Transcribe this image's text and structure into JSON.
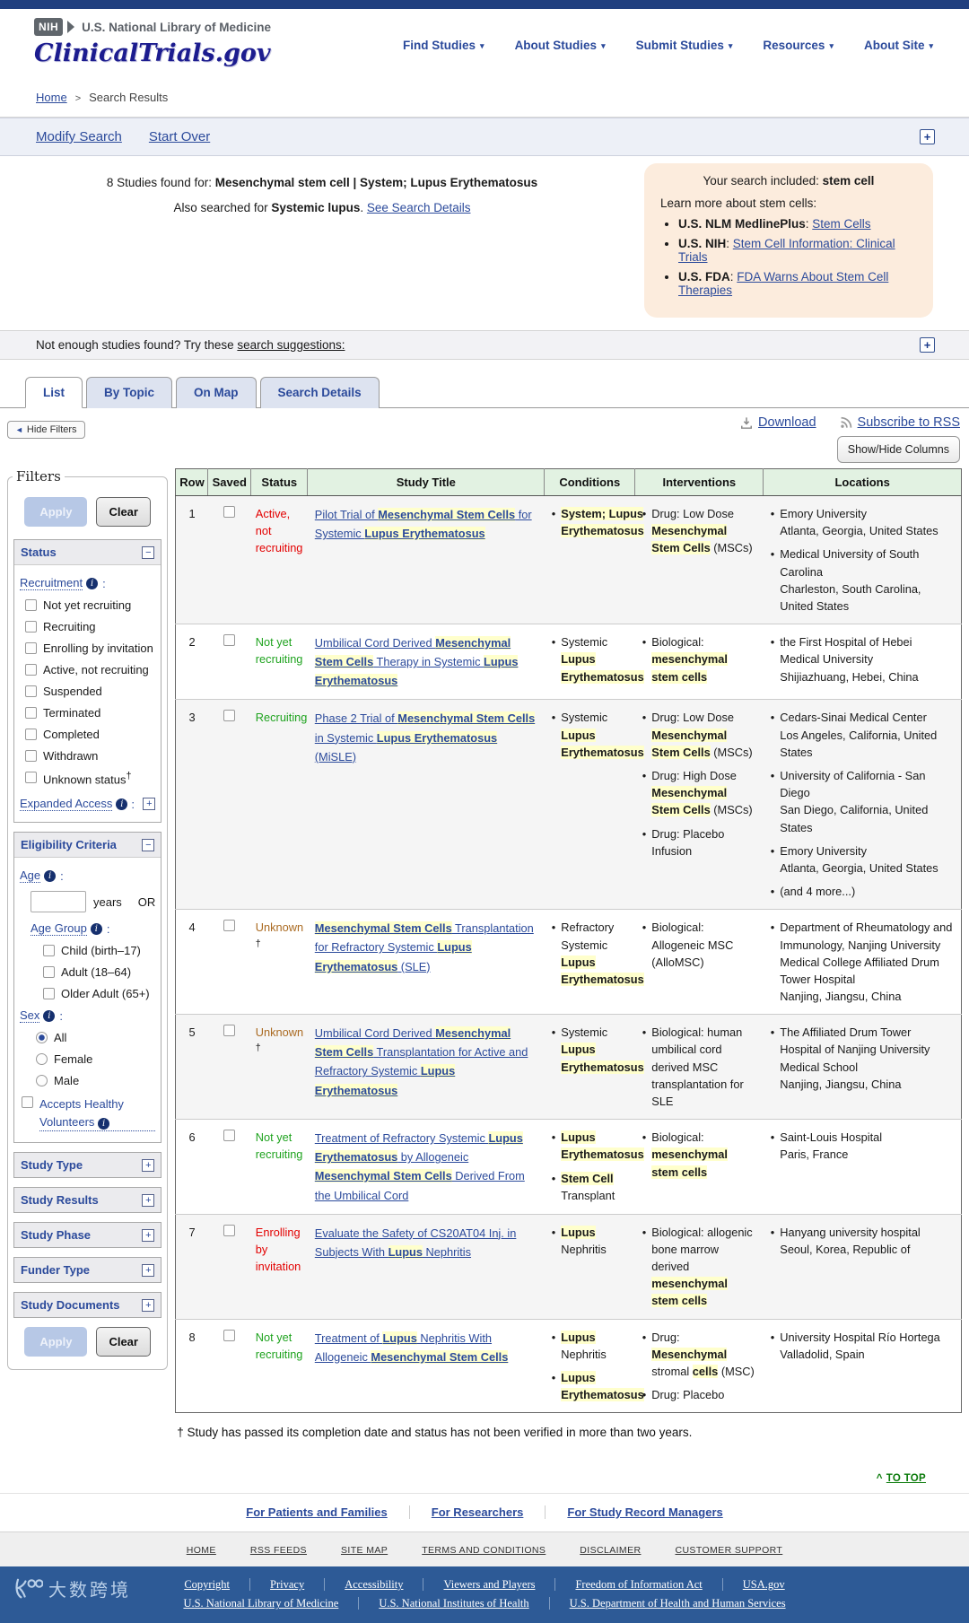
{
  "colors": {
    "accent_blue": "#2b4a9b",
    "navy_bar": "#21407f",
    "footer_navy": "#2d5a96",
    "status_red": "#e30000",
    "status_green": "#1fa31f",
    "status_unknown": "#aa6a21",
    "highlight": "#ffffcc",
    "table_header_green": "#e2f2e2",
    "info_box_bg": "#fcecdd"
  },
  "dagger": "†",
  "header": {
    "nih_label": "NIH",
    "org": "U.S. National Library of Medicine",
    "site_title": "ClinicalTrials.gov",
    "nav": [
      "Find Studies",
      "About Studies",
      "Submit Studies",
      "Resources",
      "About Site"
    ]
  },
  "breadcrumb": {
    "home": "Home",
    "current": "Search Results"
  },
  "toolbar": {
    "modify_search": "Modify Search",
    "start_over": "Start Over"
  },
  "results_summary": {
    "count_prefix": "8 Studies found for: ",
    "count_bold": "Mesenchymal stem cell | System; Lupus Erythematosus",
    "also_prefix": "Also searched for ",
    "also_bold": "Systemic lupus",
    "also_suffix": ". ",
    "see_details_link": "See Search Details"
  },
  "info_box": {
    "title_prefix": "Your search included: ",
    "title_bold": "stem cell",
    "subtitle": "Learn more about stem cells:",
    "items": [
      {
        "label": "U.S. NLM MedlinePlus",
        "link": "Stem Cells"
      },
      {
        "label": "U.S. NIH",
        "link": "Stem Cell Information: Clinical Trials"
      },
      {
        "label": "U.S. FDA",
        "link": "FDA Warns About Stem Cell Therapies"
      }
    ]
  },
  "suggestions_bar": {
    "prefix": "Not enough studies found? Try these ",
    "link": "search suggestions:"
  },
  "tabs": [
    "List",
    "By Topic",
    "On Map",
    "Search Details"
  ],
  "active_tab": "List",
  "hide_filters_label": "Hide Filters",
  "actions": {
    "download": "Download",
    "rss": "Subscribe to RSS",
    "columns": "Show/Hide Columns"
  },
  "filters": {
    "legend": "Filters",
    "apply": "Apply",
    "clear": "Clear",
    "status_panel": {
      "title": "Status",
      "recruitment_label": "Recruitment",
      "options": [
        "Not yet recruiting",
        "Recruiting",
        "Enrolling by invitation",
        "Active, not recruiting",
        "Suspended",
        "Terminated",
        "Completed",
        "Withdrawn",
        "Unknown status"
      ],
      "dagger_option": "Unknown status",
      "expanded_access_label": "Expanded Access"
    },
    "eligibility_panel": {
      "title": "Eligibility Criteria",
      "age_label": "Age",
      "age_value": "",
      "age_unit": "years",
      "or_label": "OR",
      "age_group_label": "Age Group",
      "age_groups": [
        "Child (birth–17)",
        "Adult (18–64)",
        "Older Adult (65+)"
      ],
      "sex_label": "Sex",
      "sex_options": [
        "All",
        "Female",
        "Male"
      ],
      "sex_selected": "All",
      "healthy_label": "Accepts Healthy Volunteers"
    },
    "collapsed_panels": [
      "Study Type",
      "Study Results",
      "Study Phase",
      "Funder Type",
      "Study Documents"
    ]
  },
  "table": {
    "headers": [
      "Row",
      "Saved",
      "Status",
      "Study Title",
      "Conditions",
      "Interventions",
      "Locations"
    ],
    "rows": [
      {
        "num": "1",
        "status": "Active, not recruiting",
        "color": "red",
        "dagger": false,
        "title": [
          {
            "t": "Pilot Trial of "
          },
          {
            "t": "Mesenchymal Stem Cells",
            "hl": true
          },
          {
            "t": " for Systemic "
          },
          {
            "t": "Lupus Erythematosus",
            "hl": true
          }
        ],
        "conditions": [
          [
            {
              "t": "System; Lupus Erythematosus",
              "hl": true
            }
          ]
        ],
        "interventions": [
          [
            {
              "t": "Drug: Low Dose "
            },
            {
              "t": "Mesenchymal Stem Cells",
              "hl": true
            },
            {
              "t": " (MSCs)"
            }
          ]
        ],
        "locations": [
          [
            "Emory University",
            "Atlanta, Georgia, United States"
          ],
          [
            "Medical University of South Carolina",
            "Charleston, South Carolina, United States"
          ]
        ]
      },
      {
        "num": "2",
        "status": "Not yet recruiting",
        "color": "green",
        "dagger": false,
        "title": [
          {
            "t": "Umbilical Cord Derived "
          },
          {
            "t": "Mesenchymal Stem Cells",
            "hl": true
          },
          {
            "t": " Therapy in Systemic "
          },
          {
            "t": "Lupus Erythematosus",
            "hl": true
          }
        ],
        "conditions": [
          [
            {
              "t": "Systemic "
            },
            {
              "t": "Lupus Erythematosus",
              "hl": true
            }
          ]
        ],
        "interventions": [
          [
            {
              "t": "Biological: "
            },
            {
              "t": "mesenchymal stem cells",
              "hl": true
            }
          ]
        ],
        "locations": [
          [
            "the First Hospital of Hebei Medical University",
            "Shijiazhuang, Hebei, China"
          ]
        ]
      },
      {
        "num": "3",
        "status": "Recruiting",
        "color": "green",
        "dagger": false,
        "title": [
          {
            "t": "Phase 2 Trial of "
          },
          {
            "t": "Mesenchymal Stem Cells",
            "hl": true
          },
          {
            "t": " in Systemic "
          },
          {
            "t": "Lupus Erythematosus",
            "hl": true
          },
          {
            "t": " (MiSLE)"
          }
        ],
        "conditions": [
          [
            {
              "t": "Systemic "
            },
            {
              "t": "Lupus Erythematosus",
              "hl": true
            }
          ]
        ],
        "interventions": [
          [
            {
              "t": "Drug: Low Dose "
            },
            {
              "t": "Mesenchymal Stem Cells",
              "hl": true
            },
            {
              "t": " (MSCs)"
            }
          ],
          [
            {
              "t": "Drug: High Dose "
            },
            {
              "t": "Mesenchymal Stem Cells",
              "hl": true
            },
            {
              "t": " (MSCs)"
            }
          ],
          [
            {
              "t": "Drug: Placebo Infusion"
            }
          ]
        ],
        "locations": [
          [
            "Cedars-Sinai Medical Center",
            "Los Angeles, California, United States"
          ],
          [
            "University of California - San Diego",
            "San Diego, California, United States"
          ],
          [
            "Emory University",
            "Atlanta, Georgia, United States"
          ],
          [
            "(and 4 more...)"
          ]
        ]
      },
      {
        "num": "4",
        "status": "Unknown",
        "color": "unknown",
        "dagger": true,
        "title": [
          {
            "t": "Mesenchymal Stem Cells",
            "hl": true
          },
          {
            "t": " Transplantation for Refractory Systemic "
          },
          {
            "t": "Lupus Erythematosus",
            "hl": true
          },
          {
            "t": " (SLE)"
          }
        ],
        "conditions": [
          [
            {
              "t": "Refractory Systemic "
            },
            {
              "t": "Lupus Erythematosus",
              "hl": true
            }
          ]
        ],
        "interventions": [
          [
            {
              "t": "Biological: Allogeneic MSC (AlloMSC)"
            }
          ]
        ],
        "locations": [
          [
            "Department of Rheumatology and Immunology, Nanjing University Medical College Affiliated Drum Tower Hospital",
            "Nanjing, Jiangsu, China"
          ]
        ]
      },
      {
        "num": "5",
        "status": "Unknown",
        "color": "unknown",
        "dagger": true,
        "title": [
          {
            "t": "Umbilical Cord Derived "
          },
          {
            "t": "Mesenchymal Stem Cells",
            "hl": true
          },
          {
            "t": " Transplantation for Active and Refractory Systemic "
          },
          {
            "t": "Lupus Erythematosus",
            "hl": true
          }
        ],
        "conditions": [
          [
            {
              "t": "Systemic "
            },
            {
              "t": "Lupus Erythematosus",
              "hl": true
            }
          ]
        ],
        "interventions": [
          [
            {
              "t": "Biological: human umbilical cord derived MSC transplantation for SLE"
            }
          ]
        ],
        "locations": [
          [
            "The Affiliated Drum Tower Hospital of Nanjing University Medical School",
            "Nanjing, Jiangsu, China"
          ]
        ]
      },
      {
        "num": "6",
        "status": "Not yet recruiting",
        "color": "green",
        "dagger": false,
        "title": [
          {
            "t": "Treatment of Refractory Systemic "
          },
          {
            "t": "Lupus Erythematosus",
            "hl": true
          },
          {
            "t": " by Allogeneic "
          },
          {
            "t": "Mesenchymal Stem Cells",
            "hl": true
          },
          {
            "t": " Derived From the Umbilical Cord"
          }
        ],
        "conditions": [
          [
            {
              "t": "Lupus Erythematosus",
              "hl": true
            }
          ],
          [
            {
              "t": "Stem Cell",
              "hl": true
            },
            {
              "t": " Transplant"
            }
          ]
        ],
        "interventions": [
          [
            {
              "t": "Biological: "
            },
            {
              "t": "mesenchymal stem cells",
              "hl": true
            }
          ]
        ],
        "locations": [
          [
            "Saint-Louis Hospital",
            "Paris, France"
          ]
        ]
      },
      {
        "num": "7",
        "status": "Enrolling by invitation",
        "color": "red",
        "dagger": false,
        "title": [
          {
            "t": "Evaluate the Safety of CS20AT04 Inj. in Subjects With "
          },
          {
            "t": "Lupus",
            "hl": true
          },
          {
            "t": " Nephritis"
          }
        ],
        "conditions": [
          [
            {
              "t": "Lupus",
              "hl": true
            },
            {
              "t": " Nephritis"
            }
          ]
        ],
        "interventions": [
          [
            {
              "t": "Biological: allogenic bone marrow derived "
            },
            {
              "t": "mesenchymal stem cells",
              "hl": true
            }
          ]
        ],
        "locations": [
          [
            "Hanyang university hospital",
            "Seoul, Korea, Republic of"
          ]
        ]
      },
      {
        "num": "8",
        "status": "Not yet recruiting",
        "color": "green",
        "dagger": false,
        "title": [
          {
            "t": "Treatment of "
          },
          {
            "t": "Lupus",
            "hl": true
          },
          {
            "t": " Nephritis With Allogeneic "
          },
          {
            "t": "Mesenchymal Stem Cells",
            "hl": true
          }
        ],
        "conditions": [
          [
            {
              "t": "Lupus",
              "hl": true
            },
            {
              "t": " Nephritis"
            }
          ],
          [
            {
              "t": "Lupus Erythematosus",
              "hl": true
            }
          ]
        ],
        "interventions": [
          [
            {
              "t": "Drug: "
            },
            {
              "t": "Mesenchymal",
              "hl": true
            },
            {
              "t": " stromal "
            },
            {
              "t": "cells",
              "hl": true
            },
            {
              "t": " (MSC)"
            }
          ],
          [
            {
              "t": "Drug: Placebo"
            }
          ]
        ],
        "locations": [
          [
            "University Hospital Río Hortega",
            "Valladolid, Spain"
          ]
        ]
      }
    ]
  },
  "footnote": "† Study has passed its completion date and status has not been verified in more than two years.",
  "footer": {
    "to_top": "TO TOP",
    "audience_links": [
      "For Patients and Families",
      "For Researchers",
      "For Study Record Managers"
    ],
    "site_links": [
      "HOME",
      "RSS FEEDS",
      "SITE MAP",
      "TERMS AND CONDITIONS",
      "DISCLAIMER",
      "CUSTOMER SUPPORT"
    ],
    "gov_links_row1": [
      "Copyright",
      "Privacy",
      "Accessibility",
      "Viewers and Players",
      "Freedom of Information Act",
      "USA.gov"
    ],
    "gov_links_row2": [
      "U.S. National Library of Medicine",
      "U.S. National Institutes of Health",
      "U.S. Department of Health and Human Services"
    ],
    "watermark": "大数跨境"
  }
}
